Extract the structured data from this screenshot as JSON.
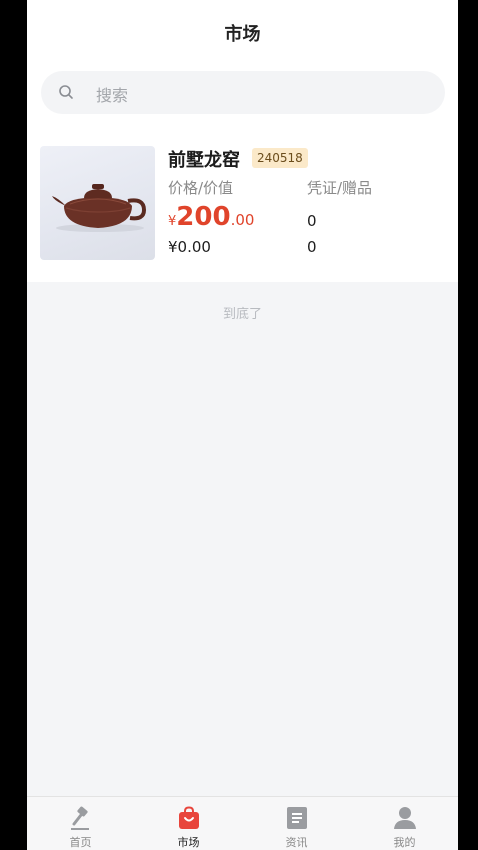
{
  "header": {
    "title": "市场"
  },
  "search": {
    "placeholder": "搜索"
  },
  "products": [
    {
      "name": "前墅龙窑",
      "badge": "240518",
      "label_left": "价格/价值",
      "label_right": "凭证/赠品",
      "price_symbol": "¥",
      "price_integer": "200",
      "price_decimal": ".00",
      "value": "¥0.00",
      "voucher_count": "0",
      "gift_count": "0",
      "image_icon": "teapot-image"
    }
  ],
  "list_end_text": "到底了",
  "tabbar": {
    "items": [
      {
        "label": "首页",
        "icon": "gavel-icon",
        "active": false
      },
      {
        "label": "市场",
        "icon": "shopping-bag-icon",
        "active": true
      },
      {
        "label": "资讯",
        "icon": "news-icon",
        "active": false
      },
      {
        "label": "我的",
        "icon": "user-icon",
        "active": false
      }
    ]
  },
  "colors": {
    "accent": "#e0442b",
    "badge_bg": "#fbe9c9",
    "page_bg": "#f4f5f7"
  }
}
